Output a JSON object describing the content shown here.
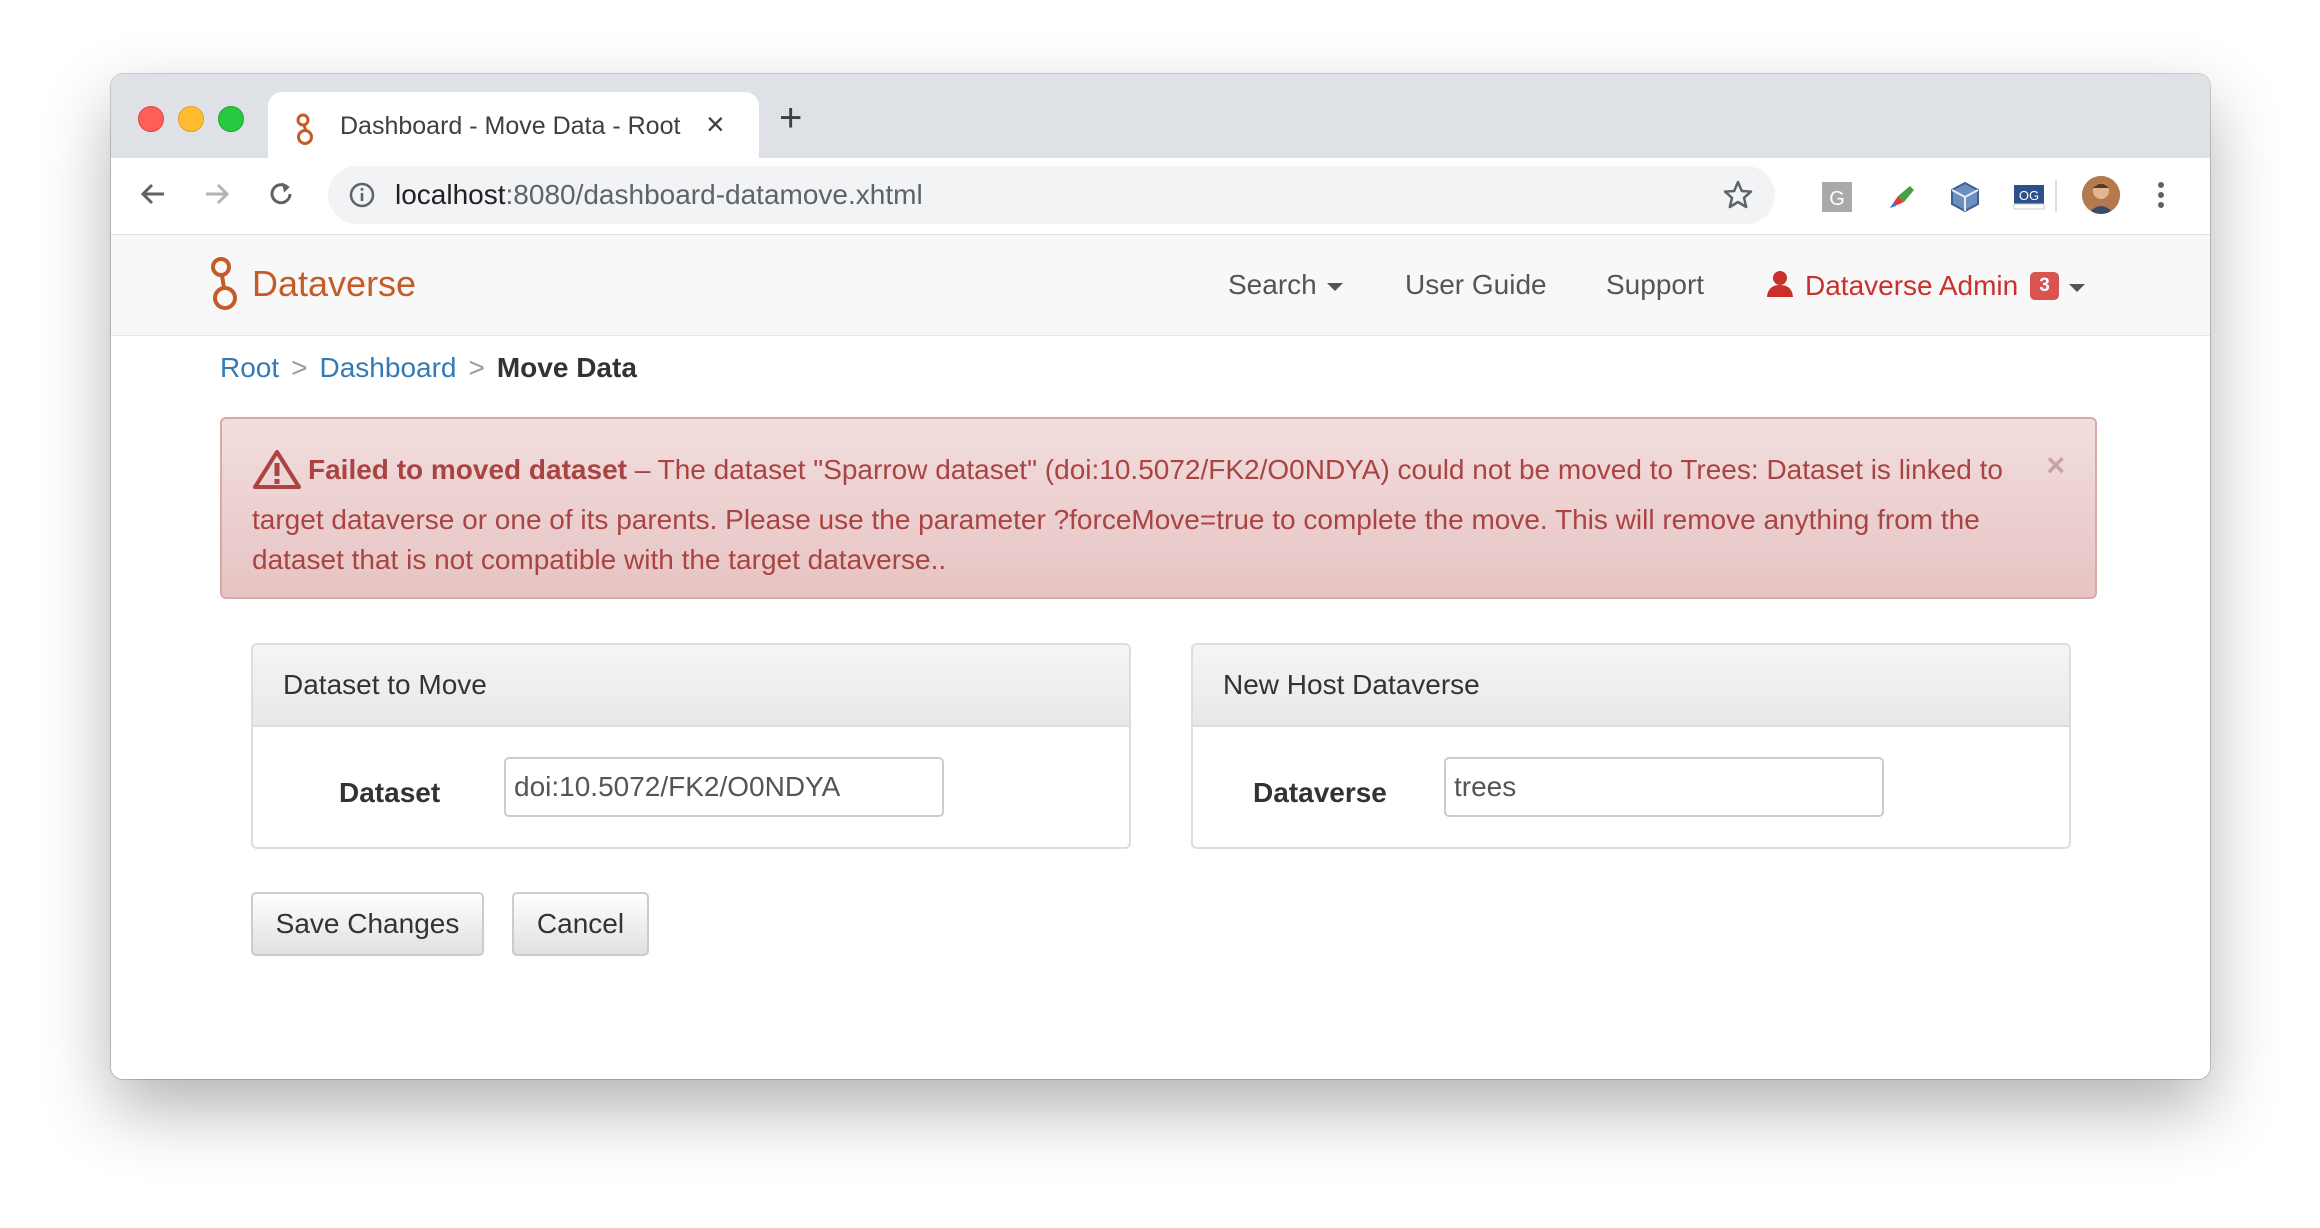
{
  "browser": {
    "tab_title": "Dashboard - Move Data - Root",
    "url_host": "localhost",
    "url_rest": ":8080/dashboard-datamove.xhtml",
    "extensions": [
      "grammarly-icon",
      "colorzilla-icon",
      "cube-extension-icon",
      "og-extension-icon"
    ],
    "ext_g_label": "G",
    "ext_og_label": "OG"
  },
  "navbar": {
    "brand": "Dataverse",
    "search": "Search",
    "user_guide": "User Guide",
    "support": "Support",
    "user": "Dataverse Admin",
    "notification_count": "3"
  },
  "breadcrumb": {
    "root": "Root",
    "dashboard": "Dashboard",
    "current": "Move Data",
    "separator": ">"
  },
  "alert": {
    "title": "Failed to moved dataset",
    "message": " – The dataset \"Sparrow dataset\" (doi:10.5072/FK2/O0NDYA) could not be moved to Trees: Dataset is linked to target dataverse or one of its parents. Please use the parameter ?forceMove=true to complete the move. This will remove anything from the dataset that is not compatible with the target dataverse..",
    "close": "×"
  },
  "dataset_panel": {
    "heading": "Dataset to Move",
    "label": "Dataset",
    "value": "doi:10.5072/FK2/O0NDYA"
  },
  "dataverse_panel": {
    "heading": "New Host Dataverse",
    "label": "Dataverse",
    "value": "trees"
  },
  "actions": {
    "save": "Save Changes",
    "cancel": "Cancel"
  },
  "colors": {
    "brand": "#c55b28",
    "link": "#337ab7",
    "alert_text": "#a94442",
    "badge": "#d9534f"
  }
}
